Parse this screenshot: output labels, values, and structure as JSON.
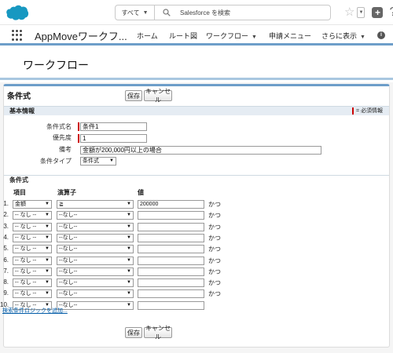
{
  "header": {
    "search_scope": "すべて",
    "search_placeholder": "Salesforce を検索"
  },
  "nav": {
    "app_name": "AppMoveワークフ...",
    "items": [
      {
        "label": "ホーム"
      },
      {
        "label": "ルート図"
      },
      {
        "label": "ワークフロー"
      },
      {
        "label": "申請メニュー"
      },
      {
        "label": "さらに表示"
      }
    ]
  },
  "page": {
    "title": "ワークフロー"
  },
  "panel": {
    "title": "条件式",
    "save_label": "保存",
    "cancel_label": "キャンセル"
  },
  "basic": {
    "section_title": "基本情報",
    "required_legend": "= 必須情報",
    "fields": {
      "name_label": "条件式名",
      "name_value": "条件1",
      "priority_label": "優先度",
      "priority_value": "1",
      "note_label": "備考",
      "note_value": "金額が200,000円以上の場合",
      "type_label": "条件タイプ",
      "type_value": "条件式"
    }
  },
  "conditions": {
    "section_title": "条件式",
    "col_item": "項目",
    "col_operator": "演算子",
    "col_value": "値",
    "conjunction": "かつ",
    "rows": [
      {
        "num": "1.",
        "item": "金額",
        "op": "≧",
        "value": "200000"
      },
      {
        "num": "2.",
        "item": "-- なし --",
        "op": "--なし--",
        "value": ""
      },
      {
        "num": "3.",
        "item": "-- なし --",
        "op": "--なし--",
        "value": ""
      },
      {
        "num": "4.",
        "item": "-- なし --",
        "op": "--なし--",
        "value": ""
      },
      {
        "num": "5.",
        "item": "-- なし --",
        "op": "--なし--",
        "value": ""
      },
      {
        "num": "6.",
        "item": "-- なし --",
        "op": "--なし--",
        "value": ""
      },
      {
        "num": "7.",
        "item": "-- なし --",
        "op": "--なし--",
        "value": ""
      },
      {
        "num": "8.",
        "item": "-- なし --",
        "op": "--なし--",
        "value": ""
      },
      {
        "num": "9.",
        "item": "-- なし --",
        "op": "--なし--",
        "value": ""
      },
      {
        "num": "10.",
        "item": "-- なし --",
        "op": "--なし--",
        "value": ""
      }
    ],
    "add_logic_link": "検索条件ロジックを追加..."
  },
  "colors": {
    "accent": "#6d9ec9",
    "required": "#cc0000",
    "logo": "#1798c1"
  }
}
